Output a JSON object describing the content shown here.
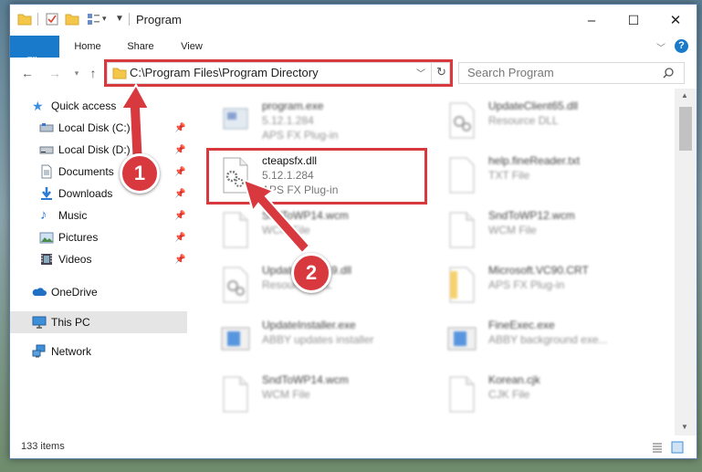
{
  "window": {
    "title": "Program",
    "controls": {
      "minimize": "–",
      "maximize": "☐",
      "close": "✕"
    }
  },
  "ribbon": {
    "tabs": [
      "File",
      "Home",
      "Share",
      "View"
    ],
    "help_glyph": "?"
  },
  "address_bar": {
    "path": "C:\\Program Files\\Program Directory"
  },
  "search": {
    "placeholder": "Search Program"
  },
  "sidebar": {
    "items": [
      {
        "label": "Quick access",
        "icon": "star-icon",
        "pinned": false
      },
      {
        "label": "Local Disk (C:)",
        "icon": "drive-icon",
        "pinned": true
      },
      {
        "label": "Local Disk (D:)",
        "icon": "drive-icon",
        "pinned": true
      },
      {
        "label": "Documents",
        "icon": "documents-icon",
        "pinned": true
      },
      {
        "label": "Downloads",
        "icon": "download-icon",
        "pinned": true
      },
      {
        "label": "Music",
        "icon": "music-icon",
        "pinned": true
      },
      {
        "label": "Pictures",
        "icon": "pictures-icon",
        "pinned": true
      },
      {
        "label": "Videos",
        "icon": "videos-icon",
        "pinned": true
      },
      {
        "label": "OneDrive",
        "icon": "cloud-icon",
        "pinned": false
      },
      {
        "label": "This PC",
        "icon": "pc-icon",
        "pinned": false,
        "selected": true
      },
      {
        "label": "Network",
        "icon": "network-icon",
        "pinned": false
      }
    ]
  },
  "files": [
    {
      "name": "program.exe",
      "line2": "5.12.1.284",
      "line3": "APS FX Plug-in",
      "icon": "exe-icon",
      "blurred": true
    },
    {
      "name": "UpdateClient65.dll",
      "line2": "Resource DLL",
      "line3": "",
      "icon": "dll-icon",
      "blurred": true
    },
    {
      "name": "cteapsfx.dll",
      "line2": "5.12.1.284",
      "line3": "APS FX Plug-in",
      "icon": "dll-gear-icon",
      "blurred": false
    },
    {
      "name": "help.fineReader.txt",
      "line2": "TXT File",
      "line3": "",
      "icon": "txt-icon",
      "blurred": true
    },
    {
      "name": "SndToWP14.wcm",
      "line2": "WCM File",
      "line3": "",
      "icon": "blank-file-icon",
      "blurred": true
    },
    {
      "name": "SndToWP12.wcm",
      "line2": "WCM File",
      "line3": "",
      "icon": "blank-file-icon",
      "blurred": true
    },
    {
      "name": "UpdateClient19.dll",
      "line2": "Resource DLL",
      "line3": "",
      "icon": "dll-icon",
      "blurred": true
    },
    {
      "name": "Microsoft.VC90.CRT",
      "line2": "APS FX Plug-in",
      "line3": "",
      "icon": "folder-file-icon",
      "blurred": true
    },
    {
      "name": "UpdateInstaller.exe",
      "line2": "ABBY updates installer",
      "line3": "",
      "icon": "app-icon",
      "blurred": true
    },
    {
      "name": "FineExec.exe",
      "line2": "ABBY background exe...",
      "line3": "",
      "icon": "app-icon",
      "blurred": true
    },
    {
      "name": "SndToWP14.wcm",
      "line2": "WCM File",
      "line3": "",
      "icon": "blank-file-icon",
      "blurred": true
    },
    {
      "name": "Korean.cjk",
      "line2": "CJK File",
      "line3": "",
      "icon": "blank-file-icon",
      "blurred": true
    }
  ],
  "status": {
    "item_count": "133 items"
  },
  "annotations": {
    "step1": "1",
    "step2": "2",
    "color": "#d8393f"
  }
}
